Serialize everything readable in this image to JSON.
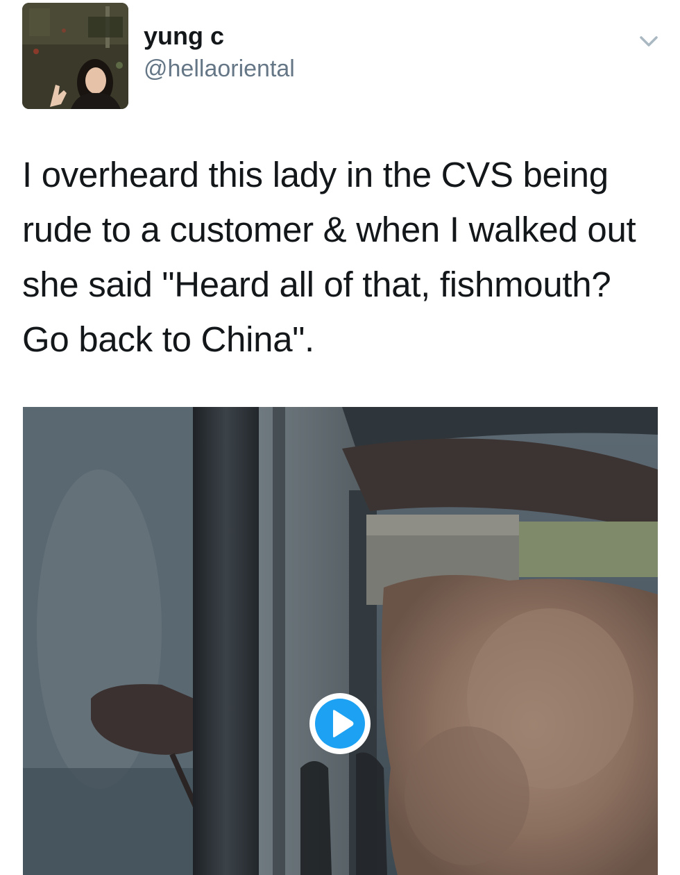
{
  "tweet": {
    "author": {
      "display_name": "yung c",
      "handle": "@hellaoriental"
    },
    "text": "I overheard this lady in the CVS being rude to a customer & when I walked out she said \"Heard all of that, fishmouth? Go back to China\".",
    "media": {
      "type": "video"
    }
  },
  "icons": {
    "menu": "chevron-down-icon",
    "play": "play-icon"
  },
  "colors": {
    "handle": "#657786",
    "text": "#14171a",
    "play_button": "#1da1f2"
  }
}
